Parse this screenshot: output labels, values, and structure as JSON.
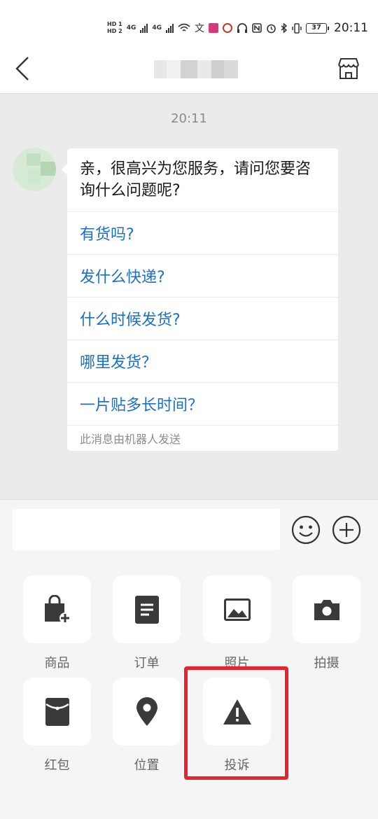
{
  "status_bar": {
    "hd1": "HD 1",
    "hd2": "HD 2",
    "net1": "4G",
    "net2": "4G",
    "battery": "37",
    "time": "20:11"
  },
  "nav": {
    "back_icon": "chevron-left-icon",
    "store_icon": "storefront-icon"
  },
  "chat": {
    "timestamp": "20:11",
    "greeting": "亲，很高兴为您服务，请问您要咨询什么问题呢?",
    "quick_questions": [
      "有货吗?",
      "发什么快递?",
      "什么时候发货?",
      "哪里发货？",
      "一片贴多长时间？"
    ],
    "footer": "此消息由机器人发送"
  },
  "input": {
    "value": "",
    "emoji_icon": "smiley-icon",
    "plus_icon": "plus-circle-icon"
  },
  "tools": [
    {
      "label": "商品",
      "icon": "shopping-bag-plus-icon"
    },
    {
      "label": "订单",
      "icon": "order-document-icon"
    },
    {
      "label": "照片",
      "icon": "photo-icon"
    },
    {
      "label": "拍摄",
      "icon": "camera-icon"
    },
    {
      "label": "红包",
      "icon": "red-envelope-icon"
    },
    {
      "label": "位置",
      "icon": "location-pin-icon"
    },
    {
      "label": "投诉",
      "icon": "warning-triangle-icon"
    }
  ],
  "colors": {
    "link_blue": "#1a6fcb",
    "highlight_red": "#e8232f",
    "icon_dark": "#3a3a3a"
  }
}
